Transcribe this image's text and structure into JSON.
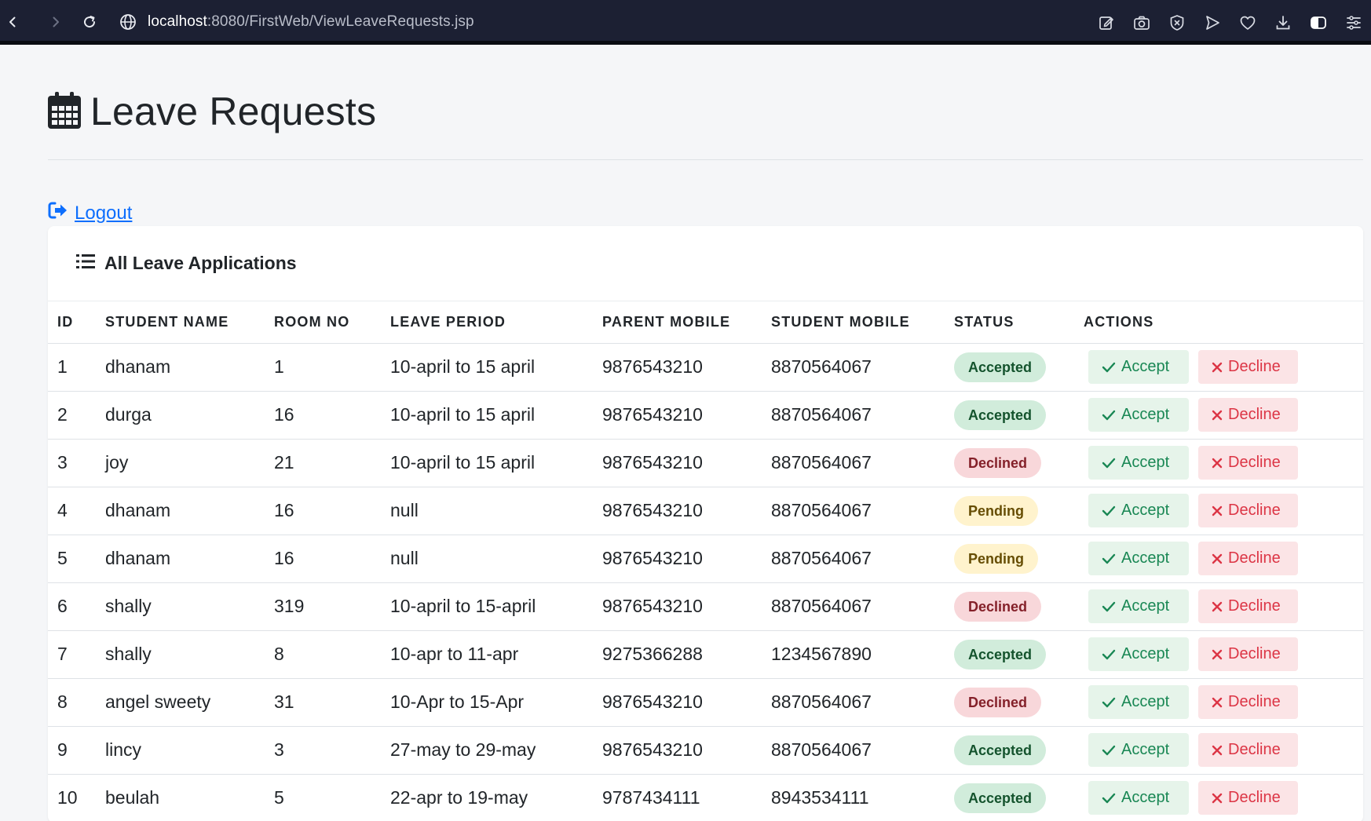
{
  "browser": {
    "url_host": "localhost",
    "url_rest": ":8080/FirstWeb/ViewLeaveRequests.jsp"
  },
  "page": {
    "title": "Leave Requests",
    "logout_label": "Logout"
  },
  "card": {
    "title": "All Leave Applications",
    "columns": [
      "ID",
      "STUDENT NAME",
      "ROOM NO",
      "LEAVE PERIOD",
      "PARENT MOBILE",
      "STUDENT MOBILE",
      "STATUS",
      "ACTIONS"
    ],
    "accept_label": "Accept",
    "decline_label": "Decline",
    "rows": [
      {
        "id": "1",
        "name": "dhanam",
        "room": "1",
        "period": "10-april to 15 april",
        "parent_mobile": "9876543210",
        "student_mobile": "8870564067",
        "status": "Accepted"
      },
      {
        "id": "2",
        "name": "durga",
        "room": "16",
        "period": "10-april to 15 april",
        "parent_mobile": "9876543210",
        "student_mobile": "8870564067",
        "status": "Accepted"
      },
      {
        "id": "3",
        "name": "joy",
        "room": "21",
        "period": "10-april to 15 april",
        "parent_mobile": "9876543210",
        "student_mobile": "8870564067",
        "status": "Declined"
      },
      {
        "id": "4",
        "name": "dhanam",
        "room": "16",
        "period": "null",
        "parent_mobile": "9876543210",
        "student_mobile": "8870564067",
        "status": "Pending"
      },
      {
        "id": "5",
        "name": "dhanam",
        "room": "16",
        "period": "null",
        "parent_mobile": "9876543210",
        "student_mobile": "8870564067",
        "status": "Pending"
      },
      {
        "id": "6",
        "name": "shally",
        "room": "319",
        "period": "10-april to 15-april",
        "parent_mobile": "9876543210",
        "student_mobile": "8870564067",
        "status": "Declined"
      },
      {
        "id": "7",
        "name": "shally",
        "room": "8",
        "period": "10-apr to 11-apr",
        "parent_mobile": "9275366288",
        "student_mobile": "1234567890",
        "status": "Accepted"
      },
      {
        "id": "8",
        "name": "angel sweety",
        "room": "31",
        "period": "10-Apr to 15-Apr",
        "parent_mobile": "9876543210",
        "student_mobile": "8870564067",
        "status": "Declined"
      },
      {
        "id": "9",
        "name": "lincy",
        "room": "3",
        "period": "27-may to 29-may",
        "parent_mobile": "9876543210",
        "student_mobile": "8870564067",
        "status": "Accepted"
      },
      {
        "id": "10",
        "name": "beulah",
        "room": "5",
        "period": "22-apr to 19-may",
        "parent_mobile": "9787434111",
        "student_mobile": "8943534111",
        "status": "Accepted"
      }
    ]
  },
  "colors": {
    "accent": "#0d6efd",
    "accept_green": "#198754",
    "decline_red": "#dc3545",
    "chrome_bg": "#1c2033"
  }
}
